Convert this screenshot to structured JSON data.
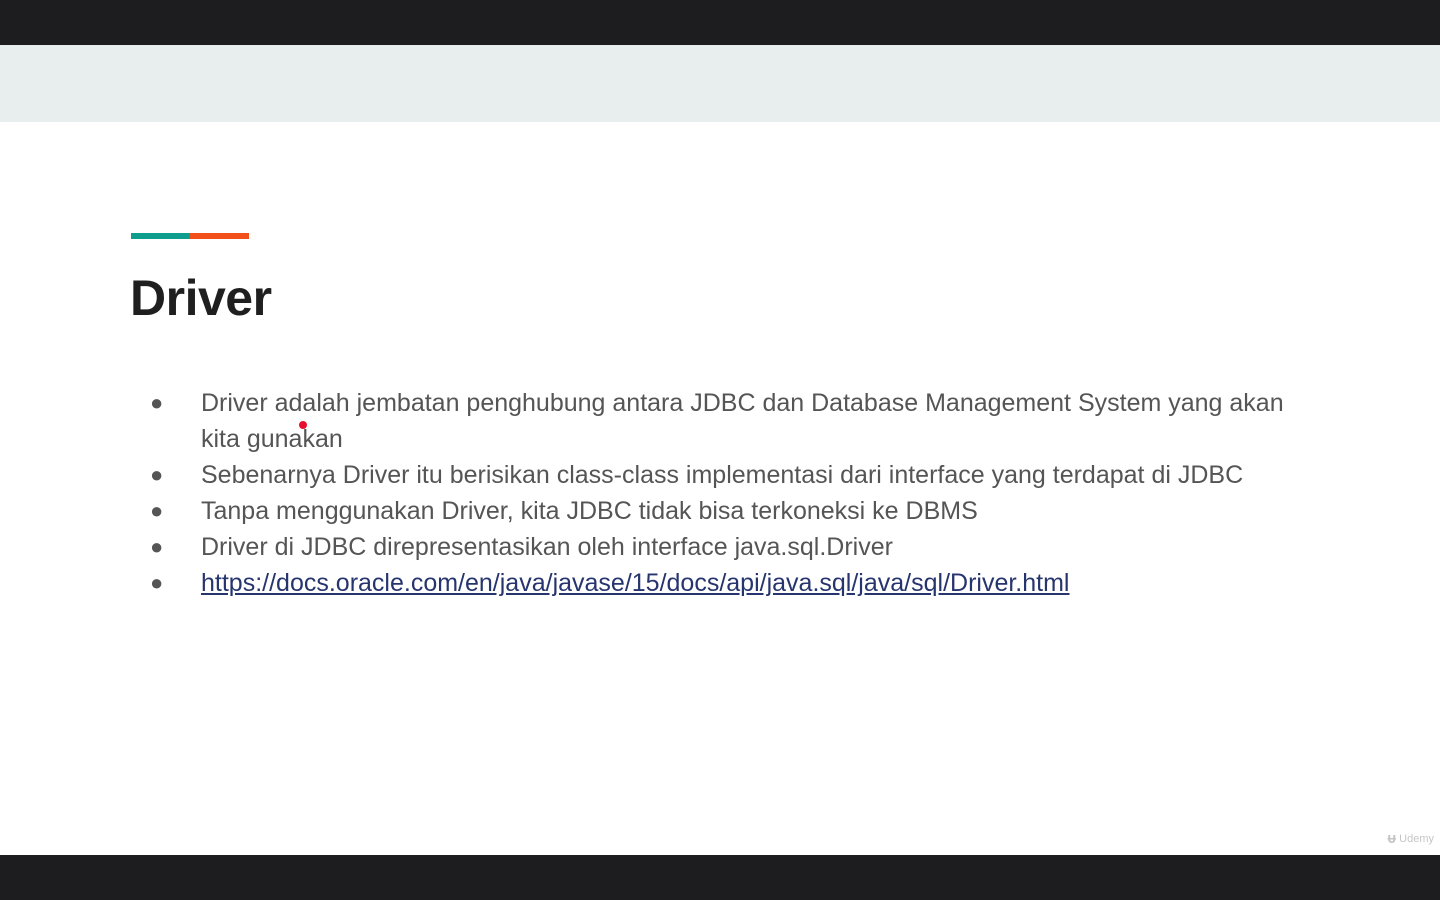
{
  "colors": {
    "frame_bar": "#1d1d1f",
    "header_band": "#e8eded",
    "accent_teal": "#0f9e8e",
    "accent_orange": "#f1501a",
    "title": "#1f1f1f",
    "body_text": "#555555",
    "link": "#27356e",
    "pointer": "#e8102e"
  },
  "slide": {
    "title": "Driver",
    "bullets": [
      {
        "text": "Driver adalah jembatan penghubung antara JDBC dan Database Management System yang akan kita gunakan"
      },
      {
        "text": "Sebenarnya Driver itu berisikan class-class implementasi dari interface yang terdapat di JDBC"
      },
      {
        "text": "Tanpa menggunakan Driver, kita JDBC tidak bisa terkoneksi ke DBMS"
      },
      {
        "text": "Driver di JDBC direpresentasikan oleh interface java.sql.Driver"
      },
      {
        "link": "https://docs.oracle.com/en/java/javase/15/docs/api/java.sql/java/sql/Driver.html"
      }
    ],
    "bullet_symbol": "●"
  },
  "watermark": {
    "icon": "udemy-logo-icon",
    "text": "Udemy"
  }
}
